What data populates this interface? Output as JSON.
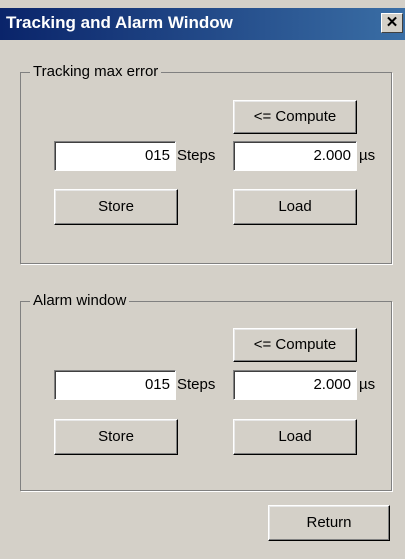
{
  "window": {
    "title": "Tracking and Alarm Window",
    "close_glyph": "✕"
  },
  "tracking": {
    "legend": "Tracking max error",
    "compute_label": "<= Compute",
    "steps_value": "015",
    "steps_unit": "Steps",
    "time_value": "2.000",
    "time_unit": "µs",
    "store_label": "Store",
    "load_label": "Load"
  },
  "alarm": {
    "legend": "Alarm window",
    "compute_label": "<= Compute",
    "steps_value": "015",
    "steps_unit": "Steps",
    "time_value": "2.000",
    "time_unit": "µs",
    "store_label": "Store",
    "load_label": "Load"
  },
  "return_label": "Return"
}
